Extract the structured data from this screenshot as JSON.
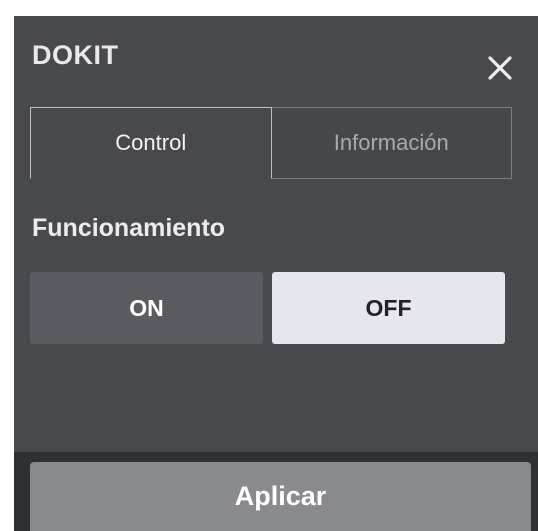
{
  "dialog": {
    "title": "DOKIT",
    "close_icon": "close-icon"
  },
  "tabs": [
    {
      "label": "Control",
      "active": true
    },
    {
      "label": "Información",
      "active": false
    }
  ],
  "operation": {
    "label": "Funcionamiento",
    "on_label": "ON",
    "off_label": "OFF",
    "selected": "OFF"
  },
  "footer": {
    "apply_label": "Aplicar"
  },
  "colors": {
    "panel_bg": "#48494c",
    "selected_toggle_bg": "#e6e6ee",
    "unselected_toggle_bg": "#5b5c61",
    "apply_button_bg": "#898a8e"
  }
}
